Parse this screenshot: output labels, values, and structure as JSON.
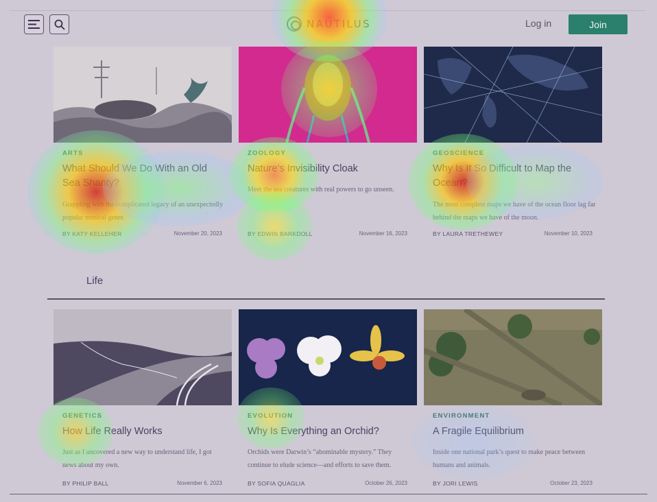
{
  "header": {
    "logo_text": "NAUTILUS",
    "login_label": "Log in",
    "join_label": "Join",
    "icons": [
      "menu-icon",
      "search-icon"
    ]
  },
  "row1": [
    {
      "category": "ARTS",
      "title": "What Should We Do With an Old Sea Shanty?",
      "description": "Grappling with the complicated legacy of an unexpectedly popular musical genre.",
      "byline": "BY KATY KELLEHER",
      "date": "November 20, 2023"
    },
    {
      "category": "ZOOLOGY",
      "title": "Nature’s Invisibility Cloak",
      "description": "Meet the sea creatures with real powers to go unseen.",
      "byline": "BY EDWIN BARKDOLL",
      "date": "November 16, 2023"
    },
    {
      "category": "GEOSCIENCE",
      "title": "Why Is It So Difficult to Map the Ocean?",
      "description": "The most complete maps we have of the ocean floor lag far behind the maps we have of the moon.",
      "byline": "BY LAURA TRETHEWEY",
      "date": "November 10, 2023"
    }
  ],
  "section": {
    "title": "Life"
  },
  "row2": [
    {
      "category": "GENETICS",
      "title": "How Life Really Works",
      "description": "Just as I uncovered a new way to understand life, I got news about my own.",
      "byline": "BY PHILIP BALL",
      "date": "November 6, 2023"
    },
    {
      "category": "EVOLUTION",
      "title": "Why Is Everything an Orchid?",
      "description": "Orchids were Darwin’s “abominable mystery.” They continue to elude science—and efforts to save them.",
      "byline": "BY SOFIA QUAGLIA",
      "date": "October 26, 2023"
    },
    {
      "category": "ENVIRONMENT",
      "title": "A Fragile Equilibrium",
      "description": "Inside one national park’s quest to make peace between humans and animals.",
      "byline": "BY JORI LEWIS",
      "date": "October 23, 2023"
    }
  ],
  "colors": {
    "accent_green": "#2a7f6d",
    "category_green": "#3e6e63",
    "overlay": "#cfc9d6"
  }
}
